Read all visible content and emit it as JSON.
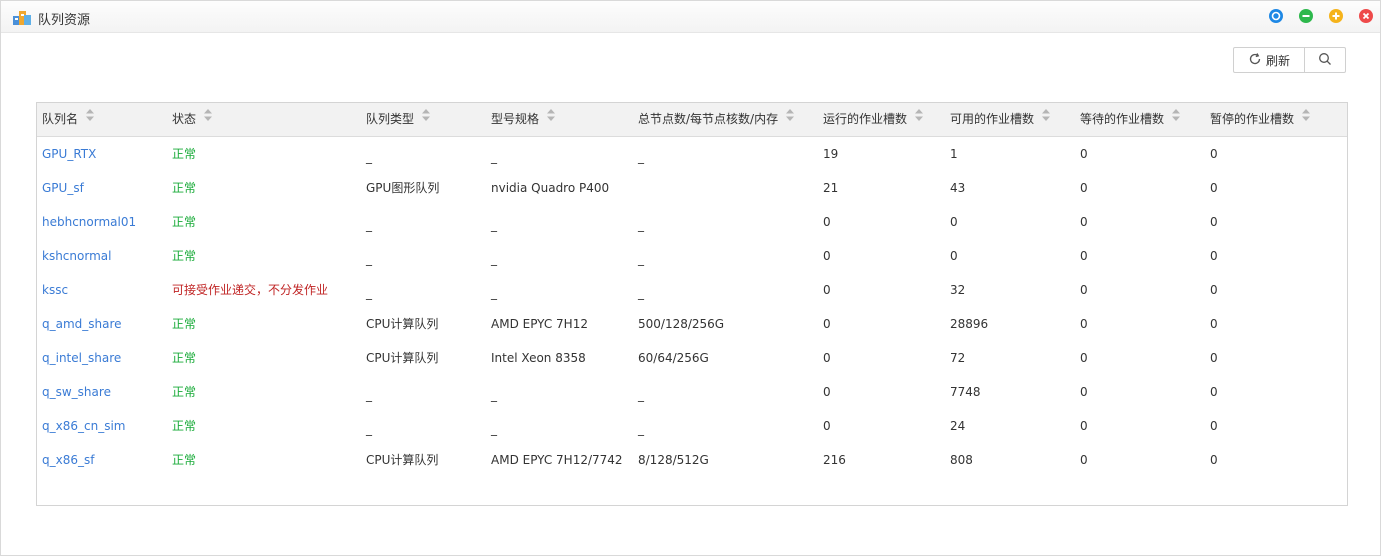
{
  "window": {
    "title": "队列资源",
    "controls": [
      {
        "name": "restore-icon",
        "color": "#1e88e5"
      },
      {
        "name": "minimize-icon",
        "color": "#2db84c"
      },
      {
        "name": "maximize-icon",
        "color": "#f5b31b"
      },
      {
        "name": "close-icon",
        "color": "#ee4a4a"
      }
    ]
  },
  "toolbar": {
    "refresh_label": "刷新",
    "refresh_icon": "refresh-icon",
    "search_icon": "search-icon"
  },
  "table": {
    "columns": [
      "队列名",
      "状态",
      "队列类型",
      "型号规格",
      "总节点数/每节点核数/内存",
      "运行的作业槽数",
      "可用的作业槽数",
      "等待的作业槽数",
      "暂停的作业槽数"
    ],
    "rows": [
      {
        "name": "GPU_RTX",
        "status": "正常",
        "status_type": "ok",
        "type": "_",
        "spec": "_",
        "nodes": "_",
        "running": "19",
        "available": "1",
        "waiting": "0",
        "paused": "0"
      },
      {
        "name": "GPU_sf",
        "status": "正常",
        "status_type": "ok",
        "type": "GPU图形队列",
        "spec": "nvidia Quadro P400",
        "nodes": "",
        "running": "21",
        "available": "43",
        "waiting": "0",
        "paused": "0"
      },
      {
        "name": "hebhcnormal01",
        "status": "正常",
        "status_type": "ok",
        "type": "_",
        "spec": "_",
        "nodes": "_",
        "running": "0",
        "available": "0",
        "waiting": "0",
        "paused": "0"
      },
      {
        "name": "kshcnormal",
        "status": "正常",
        "status_type": "ok",
        "type": "_",
        "spec": "_",
        "nodes": "_",
        "running": "0",
        "available": "0",
        "waiting": "0",
        "paused": "0"
      },
      {
        "name": "kssc",
        "status": "可接受作业递交，不分发作业",
        "status_type": "err",
        "type": "_",
        "spec": "_",
        "nodes": "_",
        "running": "0",
        "available": "32",
        "waiting": "0",
        "paused": "0"
      },
      {
        "name": "q_amd_share",
        "status": "正常",
        "status_type": "ok",
        "type": "CPU计算队列",
        "spec": "AMD EPYC 7H12",
        "nodes": "500/128/256G",
        "running": "0",
        "available": "28896",
        "waiting": "0",
        "paused": "0"
      },
      {
        "name": "q_intel_share",
        "status": "正常",
        "status_type": "ok",
        "type": "CPU计算队列",
        "spec": "Intel Xeon 8358",
        "nodes": "60/64/256G",
        "running": "0",
        "available": "72",
        "waiting": "0",
        "paused": "0"
      },
      {
        "name": "q_sw_share",
        "status": "正常",
        "status_type": "ok",
        "type": "_",
        "spec": "_",
        "nodes": "_",
        "running": "0",
        "available": "7748",
        "waiting": "0",
        "paused": "0"
      },
      {
        "name": "q_x86_cn_sim",
        "status": "正常",
        "status_type": "ok",
        "type": "_",
        "spec": "_",
        "nodes": "_",
        "running": "0",
        "available": "24",
        "waiting": "0",
        "paused": "0"
      },
      {
        "name": "q_x86_sf",
        "status": "正常",
        "status_type": "ok",
        "type": "CPU计算队列",
        "spec": "AMD EPYC 7H12/7742",
        "nodes": "8/128/512G",
        "running": "216",
        "available": "808",
        "waiting": "0",
        "paused": "0"
      }
    ]
  }
}
